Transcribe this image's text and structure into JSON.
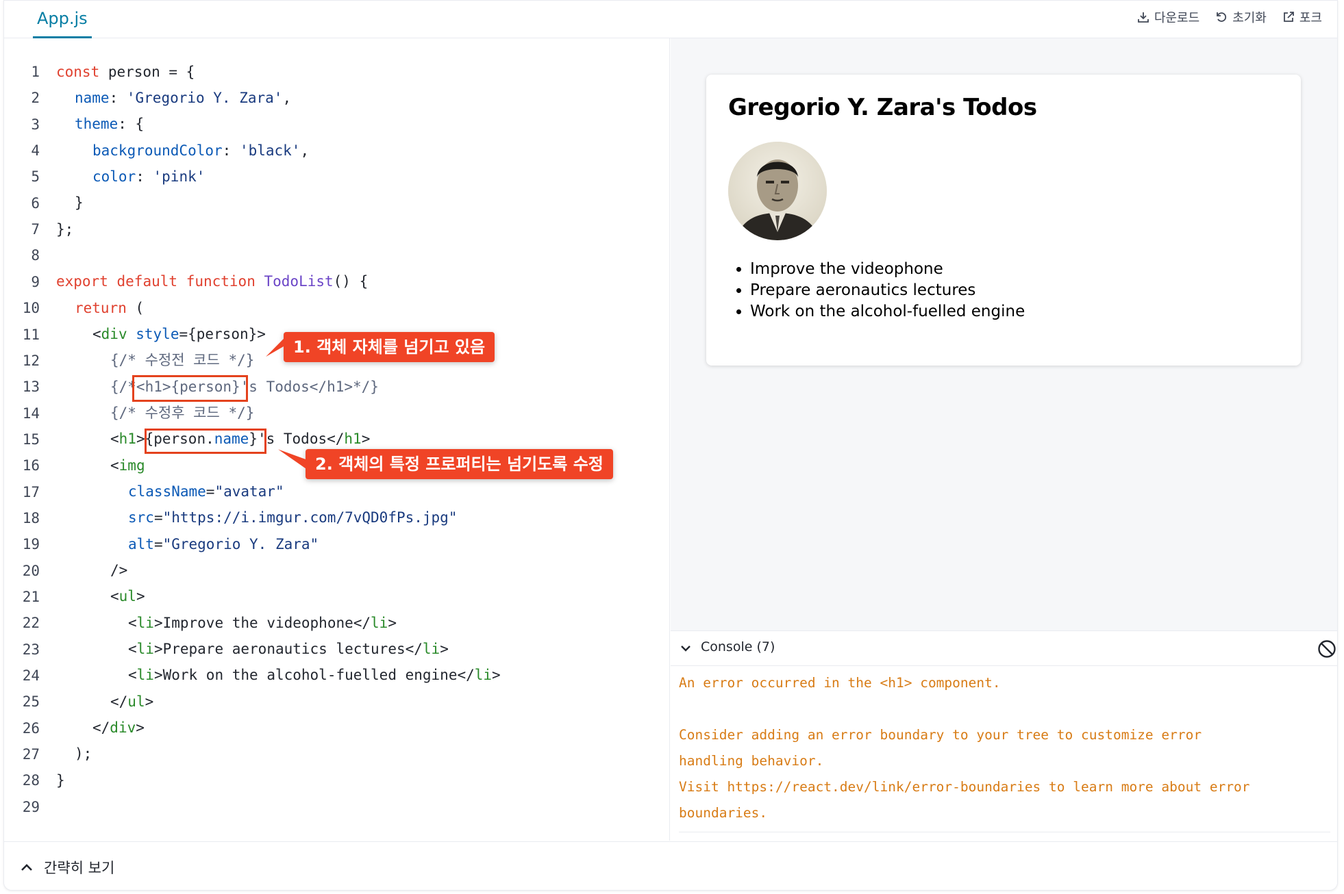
{
  "file_tab": "App.js",
  "actions": [
    {
      "icon": "download-icon",
      "label": "다운로드"
    },
    {
      "icon": "reset-icon",
      "label": "초기화"
    },
    {
      "icon": "external-link-icon",
      "label": "포크"
    }
  ],
  "code_lines": [
    {
      "n": "1"
    },
    {
      "n": "2"
    },
    {
      "n": "3"
    },
    {
      "n": "4"
    },
    {
      "n": "5"
    },
    {
      "n": "6"
    },
    {
      "n": "7"
    },
    {
      "n": "8"
    },
    {
      "n": "9"
    },
    {
      "n": "10"
    },
    {
      "n": "11"
    },
    {
      "n": "12"
    },
    {
      "n": "13"
    },
    {
      "n": "14"
    },
    {
      "n": "15"
    },
    {
      "n": "16"
    },
    {
      "n": "17"
    },
    {
      "n": "18"
    },
    {
      "n": "19"
    },
    {
      "n": "20"
    },
    {
      "n": "21"
    },
    {
      "n": "22"
    },
    {
      "n": "23"
    },
    {
      "n": "24"
    },
    {
      "n": "25"
    },
    {
      "n": "26"
    },
    {
      "n": "27"
    },
    {
      "n": "28"
    },
    {
      "n": "29"
    }
  ],
  "code": {
    "l1": [
      "const",
      " person = {"
    ],
    "l2": [
      "name",
      ": ",
      "'Gregorio Y. Zara'",
      ","
    ],
    "l3": [
      "theme",
      ": {"
    ],
    "l4": [
      "backgroundColor",
      ": ",
      "'black'",
      ","
    ],
    "l5": [
      "color",
      ": ",
      "'pink'"
    ],
    "l6": [
      "}"
    ],
    "l7": [
      "};"
    ],
    "l9": [
      "export",
      " ",
      "default",
      " ",
      "function",
      " ",
      "TodoList",
      "() {"
    ],
    "l10": [
      "return",
      " ("
    ],
    "l11": [
      "<",
      "div",
      " ",
      "style",
      "={person}>"
    ],
    "l12": [
      "{/* 수정전 코드 */}"
    ],
    "l13": [
      "{/*<h1>{person}'s Todos</h1>*/}"
    ],
    "l14": [
      "{/* 수정후 코드 */}"
    ],
    "l15": [
      "<",
      "h1",
      ">{person.",
      "name",
      "}'s Todos</",
      "h1",
      ">"
    ],
    "l16": [
      "<",
      "img"
    ],
    "l17": [
      "className",
      "=",
      "\"avatar\""
    ],
    "l18": [
      "src",
      "=",
      "\"https://i.imgur.com/7vQD0fPs.jpg\""
    ],
    "l19": [
      "alt",
      "=",
      "\"Gregorio Y. Zara\""
    ],
    "l20": [
      "/>"
    ],
    "l21": [
      "<",
      "ul",
      ">"
    ],
    "l22": [
      "<",
      "li",
      ">Improve the videophone</",
      "li",
      ">"
    ],
    "l23": [
      "<",
      "li",
      ">Prepare aeronautics lectures</",
      "li",
      ">"
    ],
    "l24": [
      "<",
      "li",
      ">Work on the alcohol-fuelled engine</",
      "li",
      ">"
    ],
    "l25": [
      "</",
      "ul",
      ">"
    ],
    "l26": [
      "</",
      "div",
      ">"
    ],
    "l27": [
      ");"
    ],
    "l28": [
      "}"
    ]
  },
  "callouts": {
    "first": "1. 객체 자체를 넘기고 있음",
    "second": "2. 객체의 특정 프로퍼티는 넘기도록 수정"
  },
  "preview": {
    "title": "Gregorio Y. Zara's Todos",
    "items": [
      "Improve the videophone",
      "Prepare aeronautics lectures",
      "Work on the alcohol-fuelled engine"
    ]
  },
  "console": {
    "label": "Console (7)",
    "line1": "An error occurred in the <h1> component.",
    "line2": "Consider adding an error boundary to your tree to customize error",
    "line3": "handling behavior.",
    "line4": "Visit https://react.dev/link/error-boundaries to learn more about error",
    "line5": "boundaries."
  },
  "bottom": {
    "label": "간략히 보기"
  },
  "colors": {
    "accent": "#087ea4",
    "callout": "#f04426",
    "error_text": "#d87c16",
    "keyword": "#e0412f"
  }
}
